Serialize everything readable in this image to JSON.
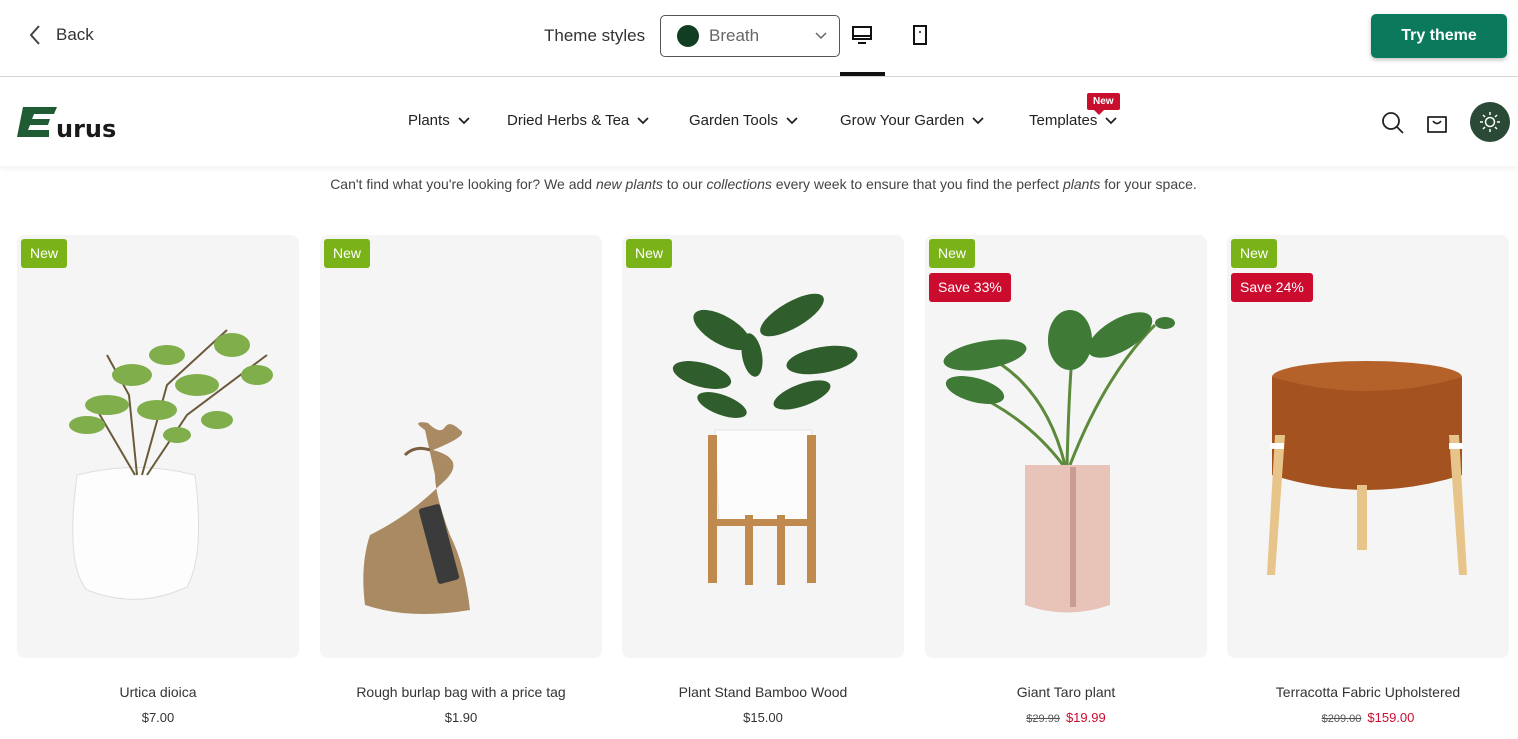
{
  "topbar": {
    "back_label": "Back",
    "theme_styles_label": "Theme styles",
    "theme_style_value": "Breath",
    "theme_style_color": "#113d23",
    "try_label": "Try theme",
    "try_color": "#0b7a5c",
    "devices": [
      "desktop-icon",
      "mobile-icon"
    ],
    "active_device": "desktop"
  },
  "store": {
    "logo_text": "Eurus",
    "nav": [
      {
        "label": "Plants"
      },
      {
        "label": "Dried Herbs & Tea"
      },
      {
        "label": "Garden Tools"
      },
      {
        "label": "Grow Your Garden"
      },
      {
        "label": "Templates",
        "badge": "New"
      }
    ],
    "icons": [
      "search-icon",
      "cart-icon",
      "sun-icon"
    ]
  },
  "tagline": {
    "part1": "Can't find what you're looking for? We add ",
    "em1": "new plants",
    "part2": " to our ",
    "em2": "collections",
    "part3": " every week to ensure that you find the perfect ",
    "em3": "plants",
    "part4": " for your space."
  },
  "products": [
    {
      "name": "Urtica dioica",
      "price": "$7.00",
      "badge_new": "New"
    },
    {
      "name": "Rough burlap bag with a price tag",
      "price": "$1.90",
      "badge_new": "New"
    },
    {
      "name": "Plant Stand Bamboo Wood",
      "price": "$15.00",
      "badge_new": "New"
    },
    {
      "name": "Giant Taro plant",
      "old_price": "$29.99",
      "sale_price": "$19.99",
      "badge_new": "New",
      "badge_save": "Save 33%"
    },
    {
      "name": "Terracotta Fabric Upholstered",
      "old_price": "$209.00",
      "sale_price": "$159.00",
      "badge_new": "New",
      "badge_save": "Save 24%"
    }
  ]
}
